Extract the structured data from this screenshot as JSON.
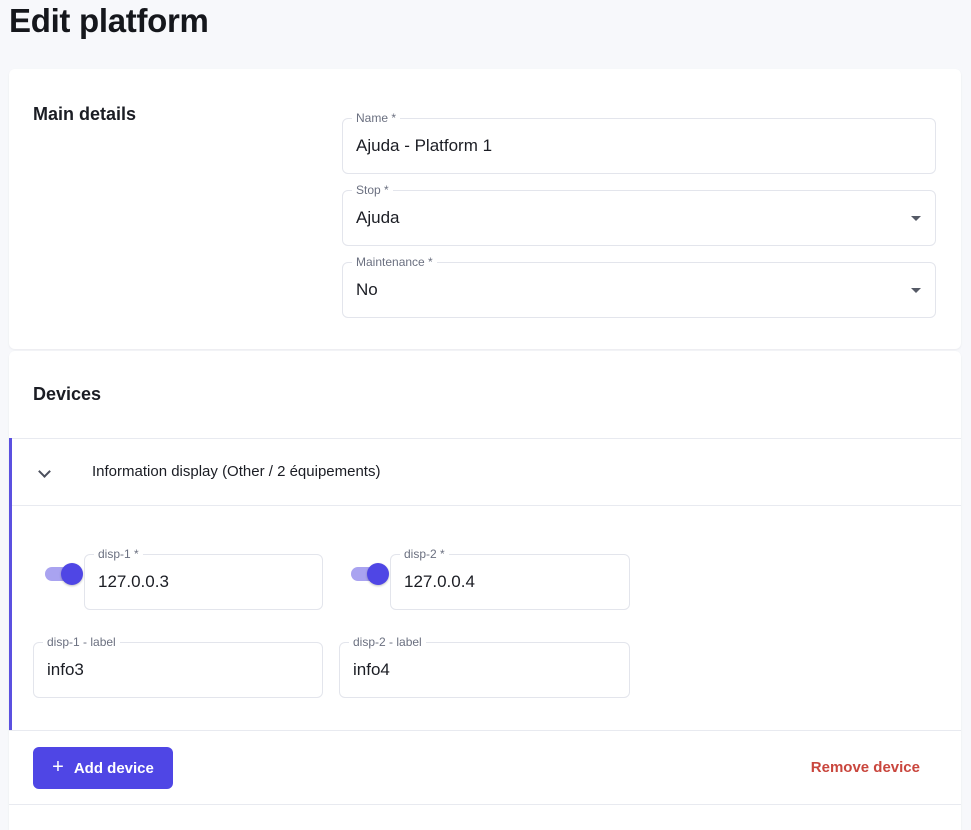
{
  "page": {
    "title": "Edit platform"
  },
  "main_details": {
    "title": "Main details",
    "name": {
      "label": "Name *",
      "value": "Ajuda - Platform 1"
    },
    "stop": {
      "label": "Stop *",
      "value": "Ajuda"
    },
    "maintenance": {
      "label": "Maintenance *",
      "value": "No"
    }
  },
  "devices": {
    "title": "Devices",
    "group": {
      "title": "Information display (Other / 2 équipements)",
      "expanded": true,
      "items": [
        {
          "ip_label": "disp-1 *",
          "ip_value": "127.0.0.3",
          "enabled": true,
          "label_label": "disp-1 - label",
          "label_value": "info3"
        },
        {
          "ip_label": "disp-2 *",
          "ip_value": "127.0.0.4",
          "enabled": true,
          "label_label": "disp-2 - label",
          "label_value": "info4"
        }
      ]
    },
    "add_button": {
      "icon": "plus-icon",
      "label": "Add device"
    },
    "remove_button": {
      "label": "Remove device"
    }
  },
  "colors": {
    "accent": "#4f46e5",
    "accent_light": "#a9a3f0",
    "danger": "#c9463d",
    "background": "#f7f8fb"
  }
}
